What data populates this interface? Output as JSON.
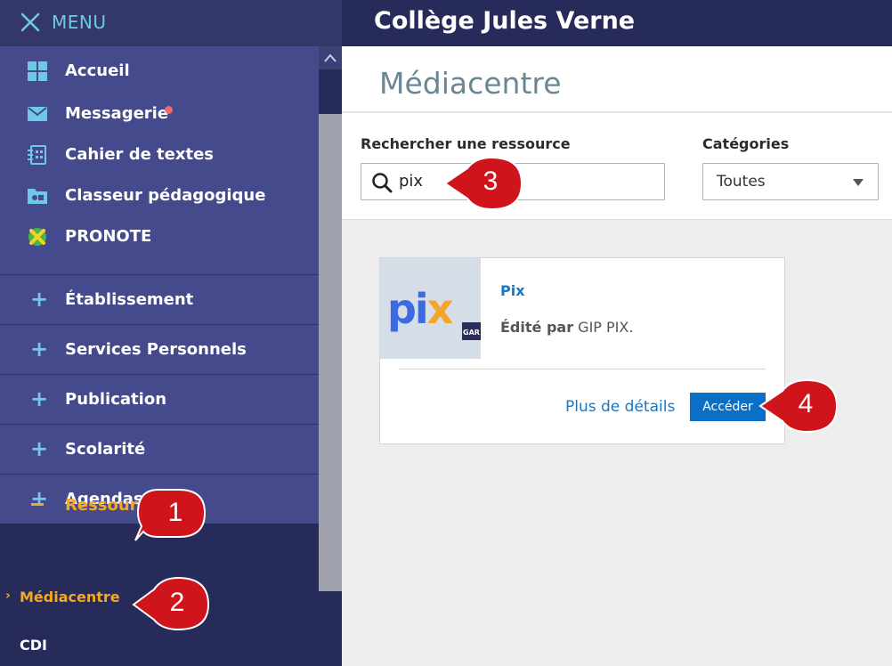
{
  "menu": {
    "label": "MENU"
  },
  "header": {
    "school_name": "Collège Jules Verne"
  },
  "sidebar": {
    "primary": [
      {
        "label": "Accueil",
        "icon": "grid-icon"
      },
      {
        "label": "Messagerie",
        "icon": "envelope-icon",
        "notification": true
      },
      {
        "label": "Cahier de textes",
        "icon": "notebook-icon"
      },
      {
        "label": "Classeur pédagogique",
        "icon": "folder-icon"
      },
      {
        "label": "PRONOTE",
        "icon": "pronote-icon"
      }
    ],
    "sections": [
      {
        "label": "Établissement",
        "expander": "+"
      },
      {
        "label": "Services Personnels",
        "expander": "+"
      },
      {
        "label": "Publication",
        "expander": "+"
      },
      {
        "label": "Scolarité",
        "expander": "+"
      },
      {
        "label": "Agendas",
        "expander": "+"
      }
    ],
    "active_section": {
      "label": "Ressources",
      "expander": "−"
    },
    "sub_items": [
      {
        "label": "Médiacentre",
        "active": true,
        "marker": "›"
      },
      {
        "label": "CDI",
        "active": false
      }
    ]
  },
  "main": {
    "title": "Médiacentre",
    "search": {
      "label": "Rechercher une ressource",
      "value": "pix"
    },
    "categories": {
      "label": "Catégories",
      "selected": "Toutes"
    },
    "card": {
      "title": "Pix",
      "editor_label": "Édité par",
      "editor": "GIP PIX.",
      "details_label": "Plus de détails",
      "access_label": "Accéder",
      "logo_text": "pix",
      "badge_text": "GAR"
    }
  },
  "callouts": [
    "1",
    "2",
    "3",
    "4"
  ],
  "colors": {
    "sidebar_bg": "#262b59",
    "nav_bg": "#444a8c",
    "accent_cyan": "#6fc8e6",
    "active_orange": "#f7a823",
    "link_blue": "#1478c9",
    "button_blue": "#0a6fc5",
    "callout_red": "#d0141c",
    "notification_dot": "#ee6b6b"
  }
}
